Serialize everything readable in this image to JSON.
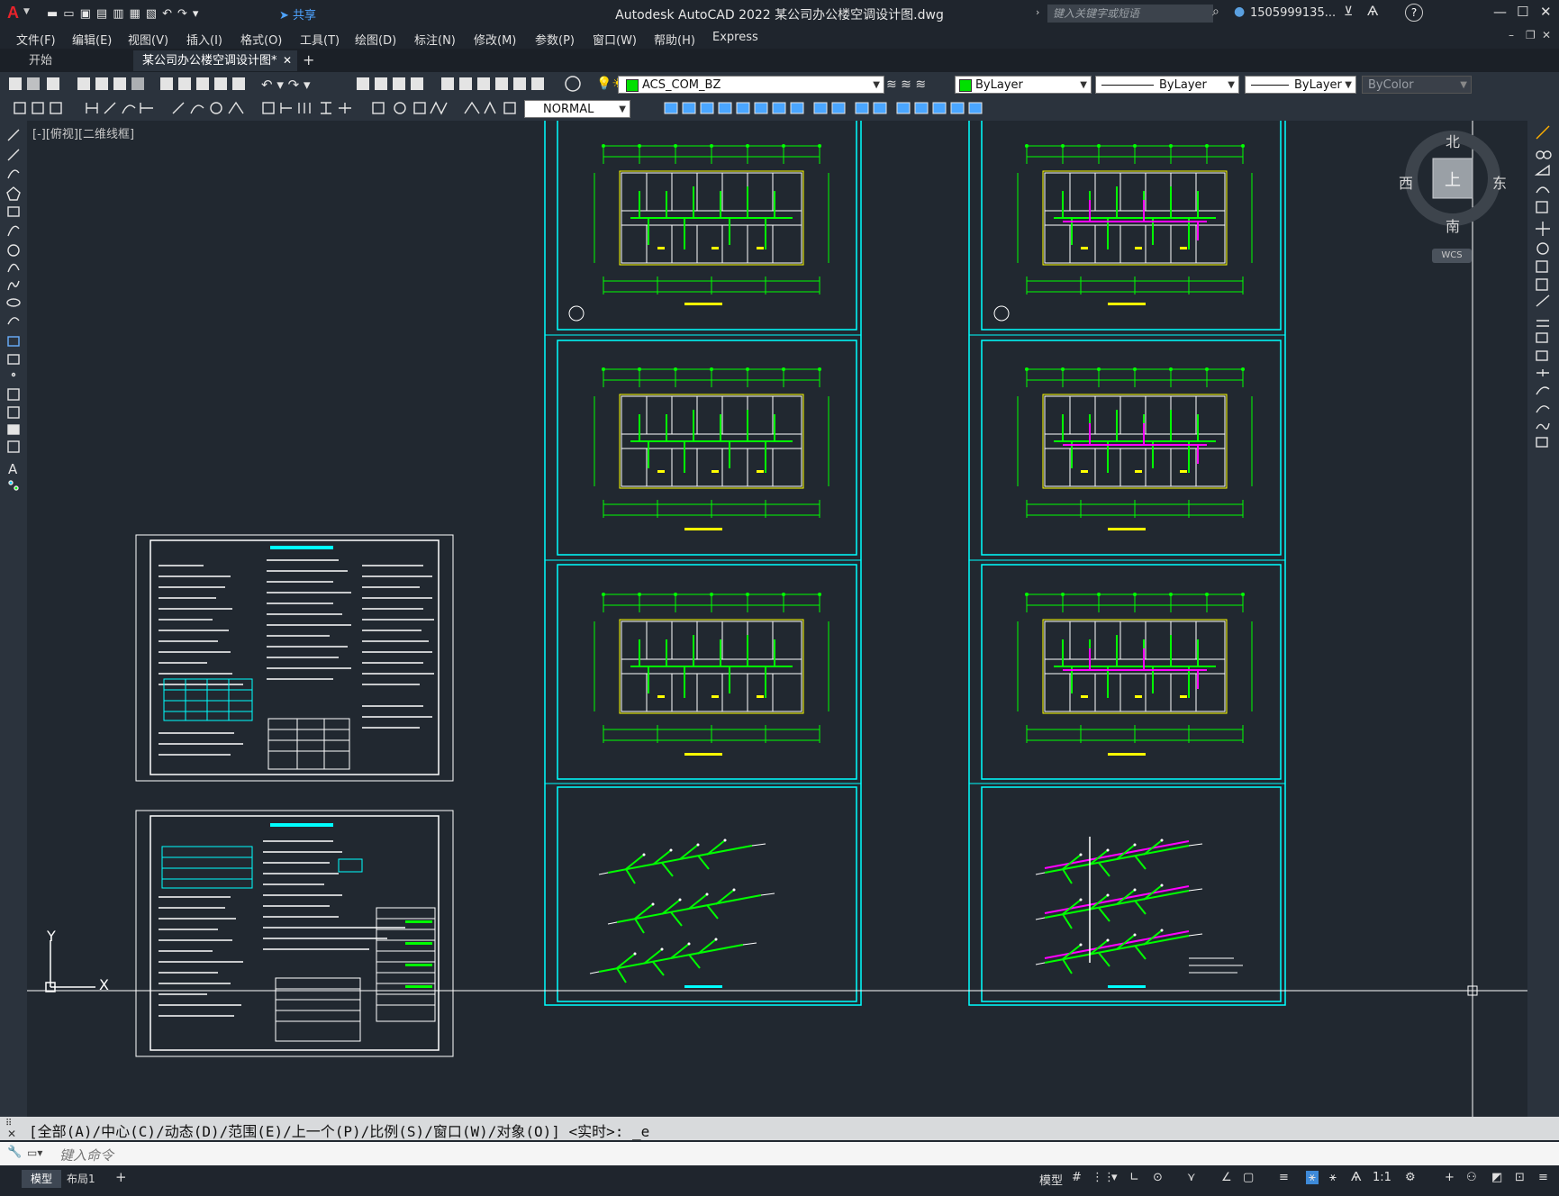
{
  "app": {
    "logo": "A",
    "title": "Autodesk AutoCAD 2022    某公司办公楼空调设计图.dwg",
    "share": "共享",
    "search_placeholder": "键入关键字或短语",
    "user": "1505999135...",
    "help": "?"
  },
  "menu": [
    "文件(F)",
    "编辑(E)",
    "视图(V)",
    "插入(I)",
    "格式(O)",
    "工具(T)",
    "绘图(D)",
    "标注(N)",
    "修改(M)",
    "参数(P)",
    "窗口(W)",
    "帮助(H)",
    "Express"
  ],
  "tabs": [
    {
      "label": "开始"
    },
    {
      "label": "某公司办公楼空调设计图*"
    }
  ],
  "toolbar": {
    "layer": "ACS_COM_BZ",
    "color": "ByLayer",
    "linetype": "ByLayer",
    "lineweight": "ByLayer",
    "plotstyle": "ByColor",
    "dimstyle": "NORMAL"
  },
  "viewport_label": "[-][俯视][二维线框]",
  "viewcube": {
    "north": "北",
    "south": "南",
    "east": "东",
    "west": "西",
    "face": "上",
    "wcs": "WCS"
  },
  "ucs": {
    "x": "X",
    "y": "Y"
  },
  "command": {
    "history": "[全部(A)/中心(C)/动态(D)/范围(E)/上一个(P)/比例(S)/窗口(W)/对象(O)] <实时>: _e",
    "placeholder": "键入命令"
  },
  "layouts": [
    {
      "label": "模型"
    },
    {
      "label": "布局1"
    }
  ],
  "status": {
    "model": "模型",
    "scale": "1:1"
  },
  "colors": {
    "frame": "#00ffff",
    "wall": "#ffff00",
    "duct": "#00ff00",
    "pipe": "#ff00ff",
    "white": "#ffffff"
  }
}
